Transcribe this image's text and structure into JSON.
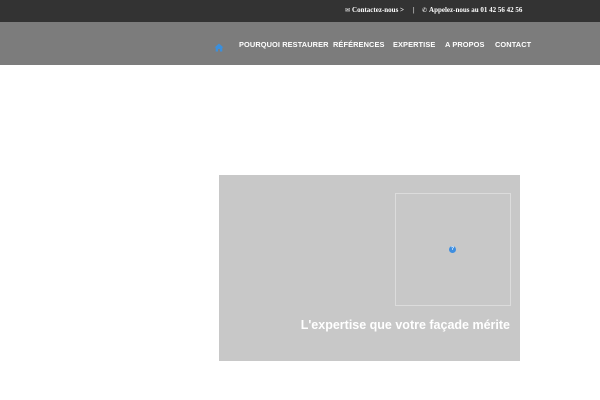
{
  "topbar": {
    "contact_label": "Contactez-nous >",
    "contact_icon": "envelope-icon",
    "separator": "|",
    "phone_label": "Appelez-nous au 01 42 56 42 56",
    "phone_icon": "phone-icon"
  },
  "nav": {
    "home_icon": "home-icon",
    "home_color": "#3b8fdc",
    "items": [
      {
        "label": "POURQUOI RESTAURER"
      },
      {
        "label": "RÉFÉRENCES"
      },
      {
        "label": "EXPERTISE"
      },
      {
        "label": "A PROPOS"
      },
      {
        "label": "CONTACT"
      }
    ]
  },
  "hero": {
    "tagline": "L'expertise que votre façade mérite",
    "image_icon": "broken-image-icon",
    "image_glyph": "?"
  },
  "colors": {
    "topbar_bg": "#333333",
    "navbar_bg": "#7c7c7c",
    "hero_bg": "#c8c8c8",
    "accent": "#3b8fdc"
  }
}
